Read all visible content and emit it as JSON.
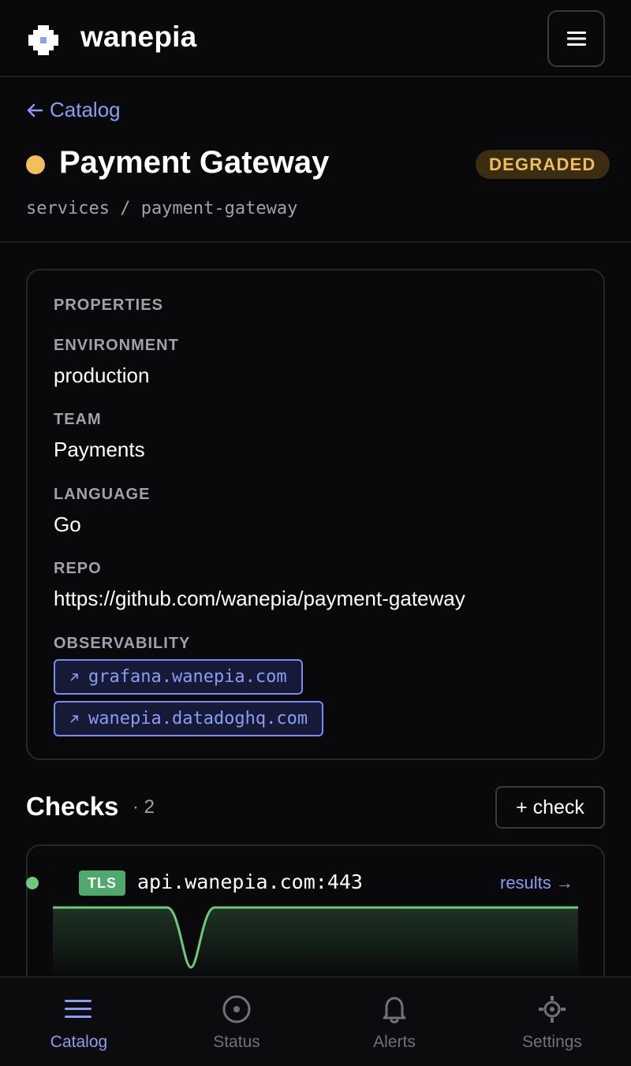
{
  "app": {
    "name": "wanepia"
  },
  "nav": {
    "back_label": "Catalog"
  },
  "service": {
    "name": "Payment Gateway",
    "status": "DEGRADED",
    "path": "services / payment-gateway",
    "status_color": "#f3be5c"
  },
  "properties": {
    "heading": "PROPERTIES",
    "environment": {
      "label": "ENVIRONMENT",
      "value": "production"
    },
    "team": {
      "label": "TEAM",
      "value": "Payments"
    },
    "language": {
      "label": "LANGUAGE",
      "value": "Go"
    },
    "repo": {
      "label": "REPO",
      "value": "https://github.com/wanepia/payment-gateway"
    },
    "observability": {
      "label": "OBSERVABILITY",
      "links": [
        {
          "icon": "arrow-up-right-icon",
          "text": "grafana.wanepia.com"
        },
        {
          "icon": "arrow-up-right-icon",
          "text": "wanepia.datadoghq.com"
        }
      ]
    }
  },
  "checks": {
    "title": "Checks",
    "count": "· 2",
    "add_label": "+ check",
    "items": [
      {
        "type": "TLS",
        "target": "api.wanepia.com:443",
        "link_label": "results →",
        "status_color": "#6cc97d"
      }
    ]
  },
  "bottom_nav": {
    "items": [
      {
        "label": "Catalog",
        "icon": "list-icon",
        "active": true
      },
      {
        "label": "Status",
        "icon": "status-icon",
        "active": false
      },
      {
        "label": "Alerts",
        "icon": "bell-icon",
        "active": false
      },
      {
        "label": "Settings",
        "icon": "gear-icon",
        "active": false
      }
    ]
  },
  "colors": {
    "accent": "#8b9cf4",
    "degraded": "#f1bc5c",
    "ok": "#6cc97d",
    "background": "#09090b"
  }
}
